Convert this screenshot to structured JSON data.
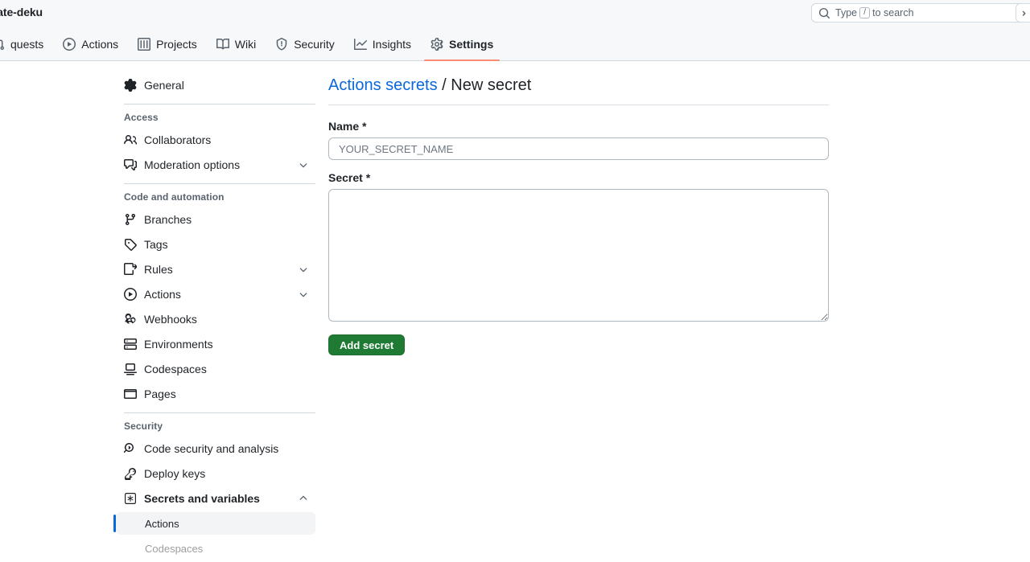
{
  "header": {
    "repo_name": "plate-deku",
    "search": {
      "placeholder_prefix": "Type",
      "key_hint": "/",
      "placeholder_suffix": "to search",
      "search_icon": "search-icon",
      "command_icon": "terminal-prompt-icon"
    },
    "tabs": [
      {
        "label": "quests",
        "icon": "pull-request-icon",
        "selected": false,
        "clipped": true
      },
      {
        "label": "Actions",
        "icon": "play-circle-icon",
        "selected": false,
        "clipped": false
      },
      {
        "label": "Projects",
        "icon": "table-icon",
        "selected": false,
        "clipped": false
      },
      {
        "label": "Wiki",
        "icon": "book-icon",
        "selected": false,
        "clipped": false
      },
      {
        "label": "Security",
        "icon": "shield-icon",
        "selected": false,
        "clipped": false
      },
      {
        "label": "Insights",
        "icon": "graph-icon",
        "selected": false,
        "clipped": false
      },
      {
        "label": "Settings",
        "icon": "gear-icon",
        "selected": true,
        "clipped": false
      }
    ]
  },
  "sidebar": {
    "general": {
      "label": "General",
      "icon": "gear-icon"
    },
    "sections": [
      {
        "heading": "Access",
        "items": [
          {
            "label": "Collaborators",
            "icon": "people-icon",
            "chevron": "none"
          },
          {
            "label": "Moderation options",
            "icon": "comment-discussion-icon",
            "chevron": "down"
          }
        ]
      },
      {
        "heading": "Code and automation",
        "items": [
          {
            "label": "Branches",
            "icon": "git-branch-icon",
            "chevron": "none"
          },
          {
            "label": "Tags",
            "icon": "tag-icon",
            "chevron": "none"
          },
          {
            "label": "Rules",
            "icon": "rules-icon",
            "chevron": "down"
          },
          {
            "label": "Actions",
            "icon": "play-circle-icon",
            "chevron": "down"
          },
          {
            "label": "Webhooks",
            "icon": "webhook-icon",
            "chevron": "none"
          },
          {
            "label": "Environments",
            "icon": "server-icon",
            "chevron": "none"
          },
          {
            "label": "Codespaces",
            "icon": "codespaces-icon",
            "chevron": "none"
          },
          {
            "label": "Pages",
            "icon": "browser-icon",
            "chevron": "none"
          }
        ]
      },
      {
        "heading": "Security",
        "items": [
          {
            "label": "Code security and analysis",
            "icon": "codescan-icon",
            "chevron": "none"
          },
          {
            "label": "Deploy keys",
            "icon": "key-icon",
            "chevron": "none"
          },
          {
            "label": "Secrets and variables",
            "icon": "asterisk-box-icon",
            "chevron": "up",
            "bold": true
          }
        ]
      }
    ],
    "sub_items": [
      {
        "label": "Actions",
        "selected": true
      },
      {
        "label": "Codespaces",
        "selected": false
      }
    ]
  },
  "main": {
    "breadcrumb_link": "Actions secrets",
    "breadcrumb_separator": "/",
    "breadcrumb_current": "New secret",
    "name_label": "Name *",
    "name_value": "",
    "name_placeholder": "YOUR_SECRET_NAME",
    "secret_label": "Secret *",
    "secret_value": "",
    "submit_label": "Add secret"
  },
  "colors": {
    "accent_blue": "#0969da",
    "tab_underline": "#fd8c73",
    "button_green": "#1f7b33",
    "header_bg": "#f6f8fa",
    "border": "#d1d9e0"
  }
}
